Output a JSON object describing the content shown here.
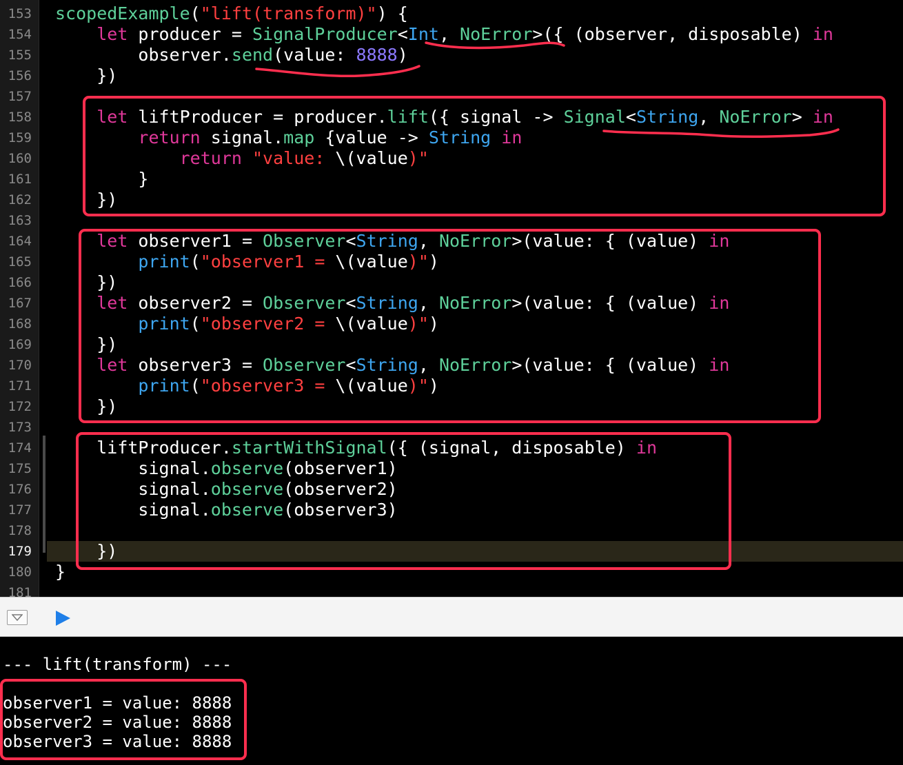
{
  "editor": {
    "current_line": "179",
    "line_numbers": [
      "153",
      "154",
      "155",
      "156",
      "157",
      "158",
      "159",
      "160",
      "161",
      "162",
      "163",
      "164",
      "165",
      "166",
      "167",
      "168",
      "169",
      "170",
      "171",
      "172",
      "173",
      "174",
      "175",
      "176",
      "177",
      "178",
      "179",
      "180",
      "181"
    ],
    "code": {
      "l153": [
        "scopedExample",
        "(",
        "\"lift(transform)\"",
        ") {"
      ],
      "l154": [
        "let",
        " producer = ",
        "SignalProducer",
        "<",
        "Int",
        ", ",
        "NoError",
        ">({ (observer, disposable) ",
        "in"
      ],
      "l155": [
        "observer.",
        "send",
        "(value: ",
        "8888",
        ")"
      ],
      "l156": [
        "})"
      ],
      "l158": [
        "let",
        " liftProducer = producer.",
        "lift",
        "({ signal -> ",
        "Signal",
        "<",
        "String",
        ", ",
        "NoError",
        "> ",
        "in"
      ],
      "l159": [
        "return",
        " signal.",
        "map",
        " {value -> ",
        "String",
        " ",
        "in"
      ],
      "l160": [
        "return",
        " ",
        "\"value: ",
        "\\(",
        "value",
        ")\""
      ],
      "l161": [
        "}"
      ],
      "l162": [
        "})"
      ],
      "l164": [
        "let",
        " observer1 = ",
        "Observer",
        "<",
        "String",
        ", ",
        "NoError",
        ">(value: { (value) ",
        "in"
      ],
      "l165": [
        "print",
        "(",
        "\"observer1 = ",
        "\\(",
        "value",
        ")\"",
        ")"
      ],
      "l166": [
        "})"
      ],
      "l167": [
        "let",
        " observer2 = ",
        "Observer",
        "<",
        "String",
        ", ",
        "NoError",
        ">(value: { (value) ",
        "in"
      ],
      "l168": [
        "print",
        "(",
        "\"observer2 = ",
        "\\(",
        "value",
        ")\"",
        ")"
      ],
      "l169": [
        "})"
      ],
      "l170": [
        "let",
        " observer3 = ",
        "Observer",
        "<",
        "String",
        ", ",
        "NoError",
        ">(value: { (value) ",
        "in"
      ],
      "l171": [
        "print",
        "(",
        "\"observer3 = ",
        "\\(",
        "value",
        ")\"",
        ")"
      ],
      "l172": [
        "})"
      ],
      "l174": [
        "liftProducer.",
        "startWithSignal",
        "({ (signal, disposable) ",
        "in"
      ],
      "l175": [
        "signal.",
        "observe",
        "(observer1)"
      ],
      "l176": [
        "signal.",
        "observe",
        "(observer2)"
      ],
      "l177": [
        "signal.",
        "observe",
        "(observer3)"
      ],
      "l179": [
        "})"
      ],
      "l180": [
        "}"
      ]
    }
  },
  "colors": {
    "keyword": "#e0389a",
    "function": "#5ed09a",
    "type": "#3ea6f0",
    "string": "#ff4040",
    "number": "#8c79ff",
    "annotation": "#ff2e4e"
  },
  "debug_bar": {
    "hide_icon": "triangle-down-icon",
    "run_icon": "play-icon"
  },
  "console": {
    "lines": [
      "--- lift(transform) ---",
      "observer1 = value: 8888",
      "observer2 = value: 8888",
      "observer3 = value: 8888"
    ]
  }
}
